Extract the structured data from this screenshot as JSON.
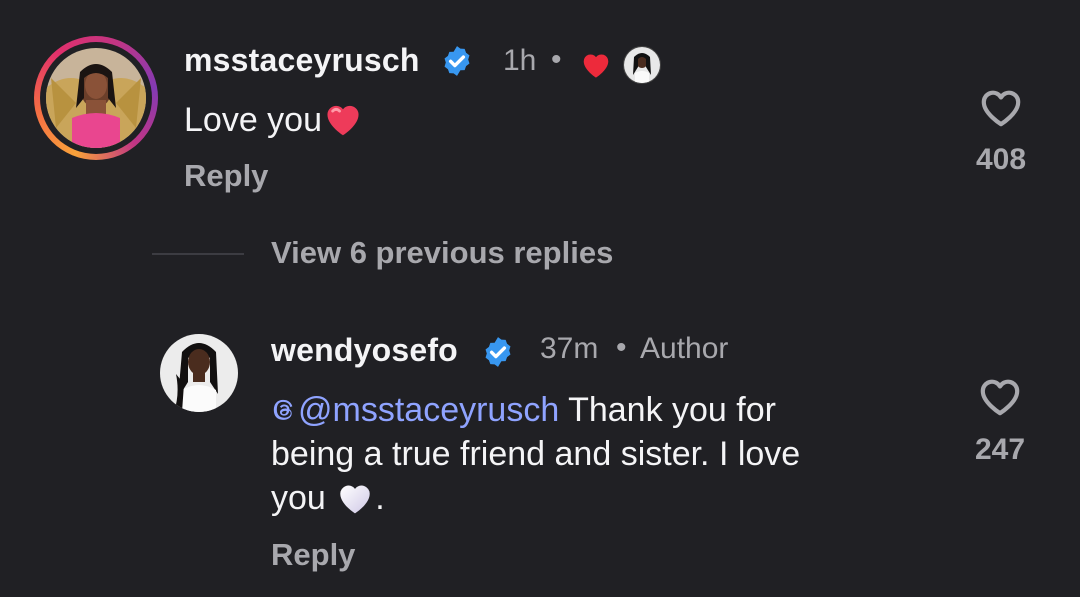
{
  "comments": [
    {
      "username": "msstaceyrusch",
      "verified": true,
      "time": "1h",
      "separator": "•",
      "liked_by_author": true,
      "text": "Love you",
      "emoji": "red-heart",
      "reply_label": "Reply",
      "like_count": "408",
      "has_story_ring": true
    },
    {
      "username": "wendyosefo",
      "verified": true,
      "time": "37m",
      "separator": "•",
      "author_badge": "Author",
      "mention": "@msstaceyrusch",
      "text_line1": " Thank you for",
      "text_line2": "being a true friend and sister. I love",
      "text_line3": "you",
      "emoji": "white-heart",
      "text_end": ".",
      "reply_label": "Reply",
      "like_count": "247"
    }
  ],
  "view_previous": {
    "label": "View 6 previous replies"
  },
  "colors": {
    "background": "#202024",
    "primary_text": "#f4f4f6",
    "secondary_text": "#a8a8ad",
    "verified_blue": "#3897f0",
    "mention_blue": "#8fa3ff",
    "heart_red": "#ed2a3b"
  }
}
